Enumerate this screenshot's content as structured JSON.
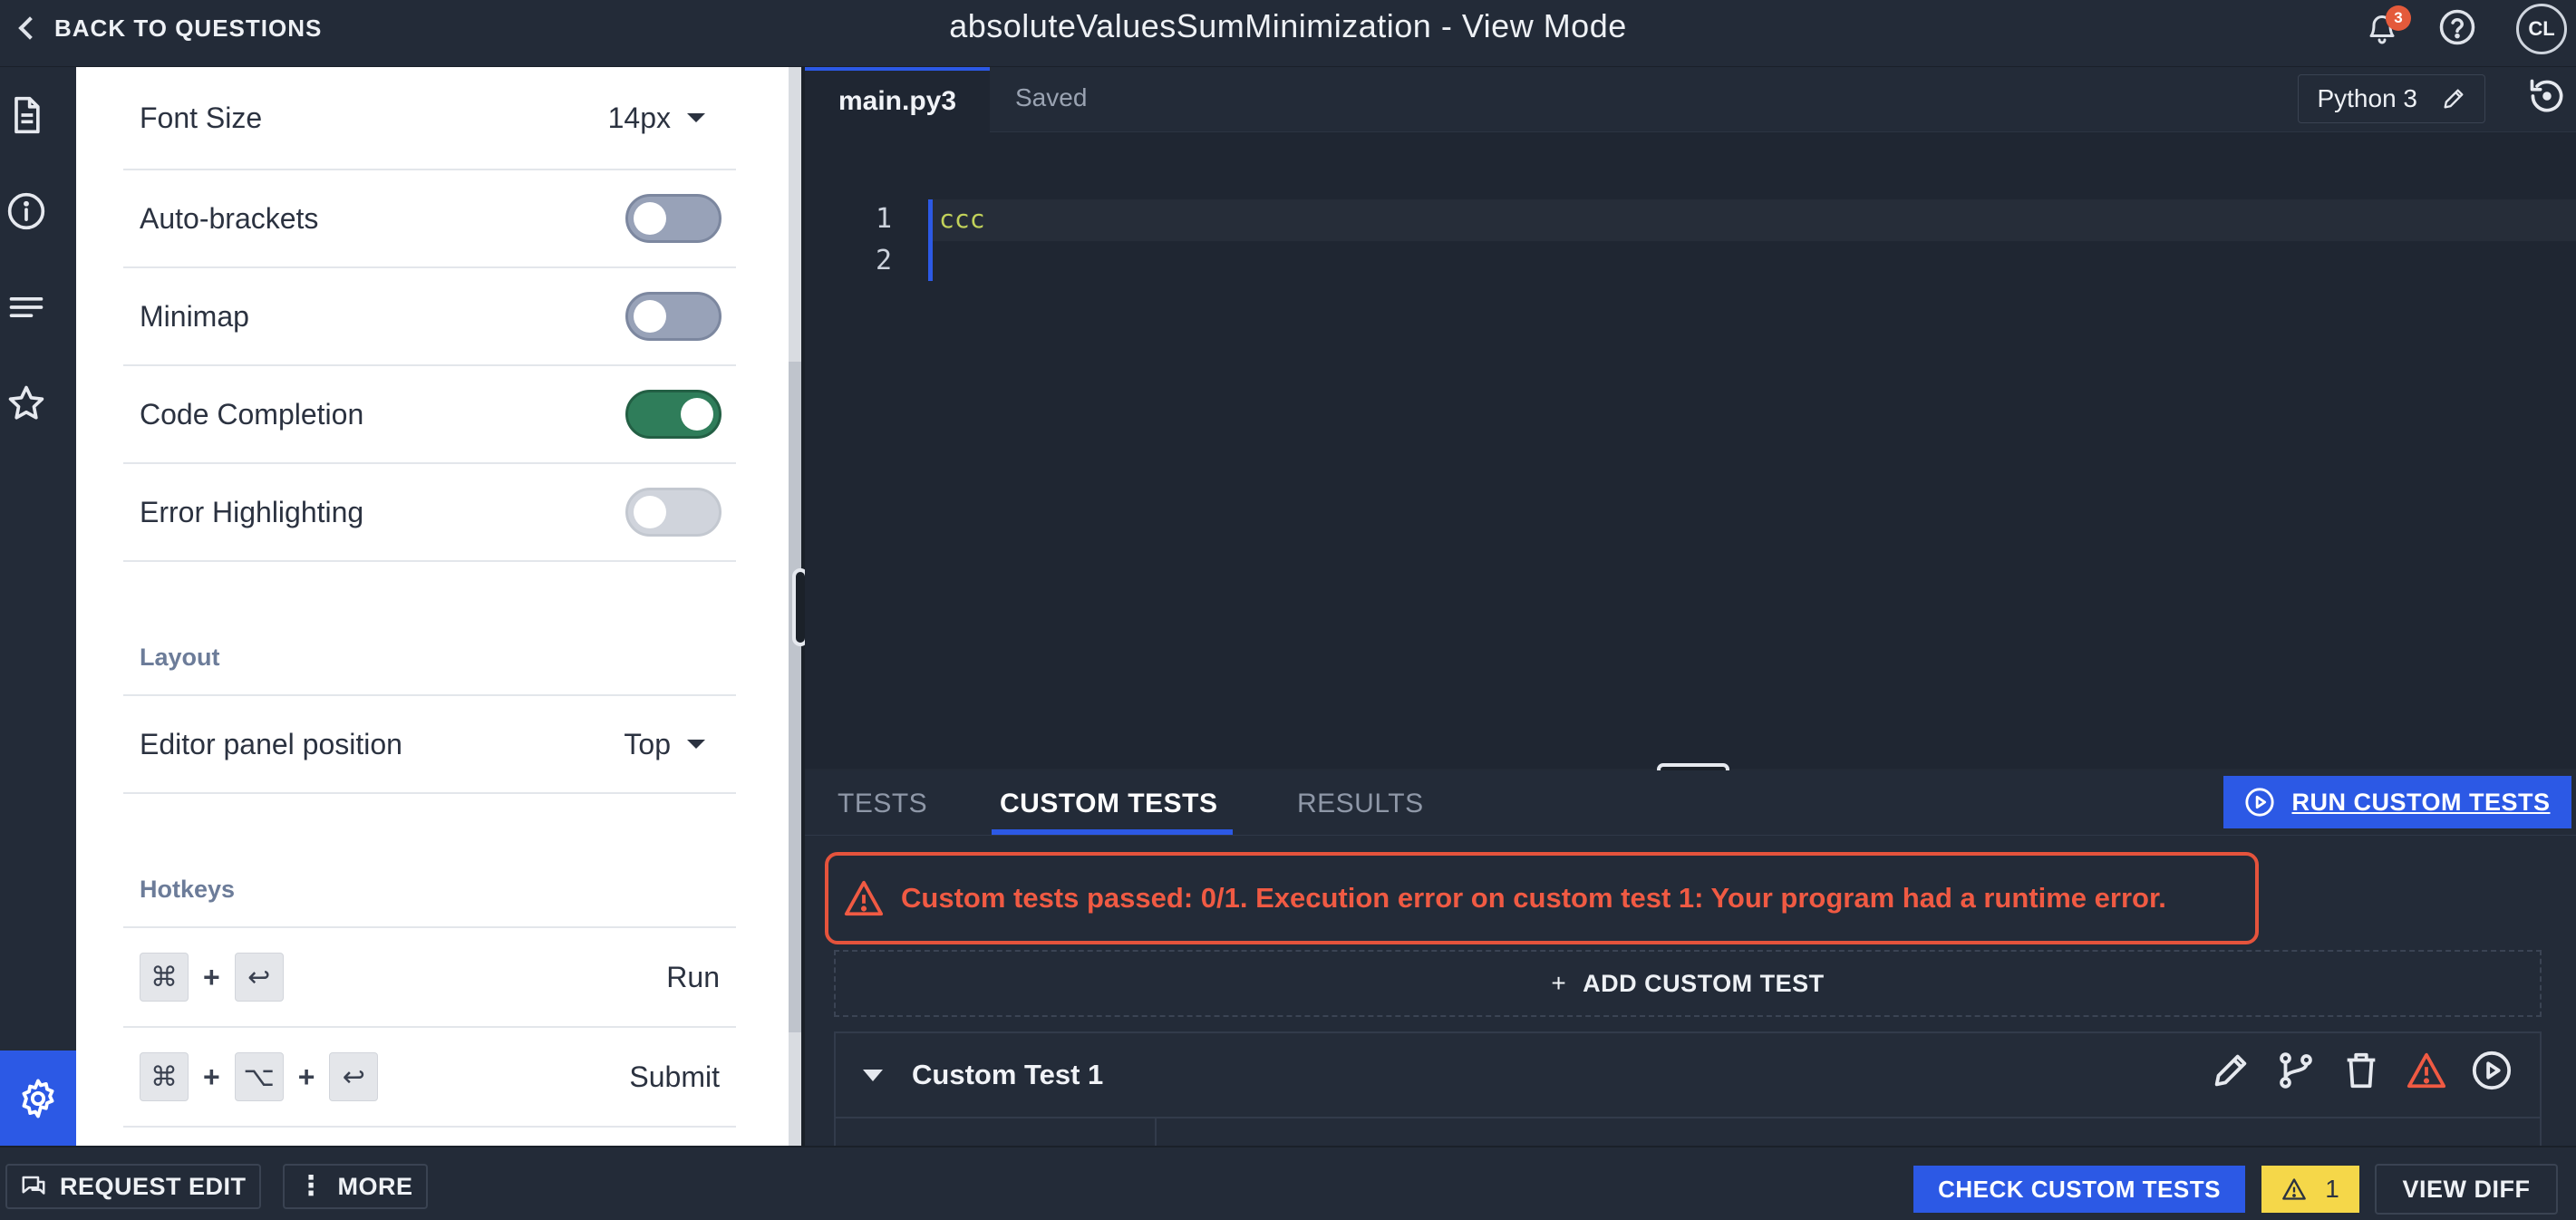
{
  "header": {
    "back_label": "BACK TO QUESTIONS",
    "title": "absoluteValuesSumMinimization - View Mode",
    "notification_count": "3",
    "avatar_initials": "CL"
  },
  "rail": {
    "icons": [
      "document-icon",
      "info-icon",
      "list-icon",
      "star-icon",
      "gear-icon"
    ]
  },
  "settings": {
    "font_size": {
      "label": "Font Size",
      "value": "14px"
    },
    "toggles": [
      {
        "label": "Auto-brackets",
        "state": "off"
      },
      {
        "label": "Minimap",
        "state": "off"
      },
      {
        "label": "Code Completion",
        "state": "on"
      },
      {
        "label": "Error Highlighting",
        "state": "disabled"
      }
    ],
    "layout_title": "Layout",
    "editor_panel": {
      "label": "Editor panel position",
      "value": "Top"
    },
    "hotkeys_title": "Hotkeys",
    "hotkeys": [
      {
        "keys": [
          "⌘",
          "↩"
        ],
        "action": "Run"
      },
      {
        "keys": [
          "⌘",
          "⌥",
          "↩"
        ],
        "action": "Submit"
      }
    ],
    "plus": "+"
  },
  "editor": {
    "tab": "main.py3",
    "status": "Saved",
    "language": "Python 3",
    "lines": [
      "1",
      "2"
    ],
    "code": "ccc"
  },
  "tests": {
    "tabs": [
      "TESTS",
      "CUSTOM TESTS",
      "RESULTS"
    ],
    "active_tab": "CUSTOM TESTS",
    "run_label": "RUN CUSTOM TESTS",
    "error_message": "Custom tests passed: 0/1. Execution error on custom test 1: Your program had a runtime error.",
    "add_label": "ADD CUSTOM TEST",
    "custom_test_name": "Custom Test 1"
  },
  "footer": {
    "request_edit": "REQUEST EDIT",
    "more": "MORE",
    "check_label": "CHECK CUSTOM TESTS",
    "warning_count": "1",
    "view_diff": "VIEW DIFF"
  },
  "colors": {
    "accent": "#2c59e5",
    "error": "#e5533c",
    "toggle_on": "#2f7d5a",
    "warning": "#f5d749"
  }
}
